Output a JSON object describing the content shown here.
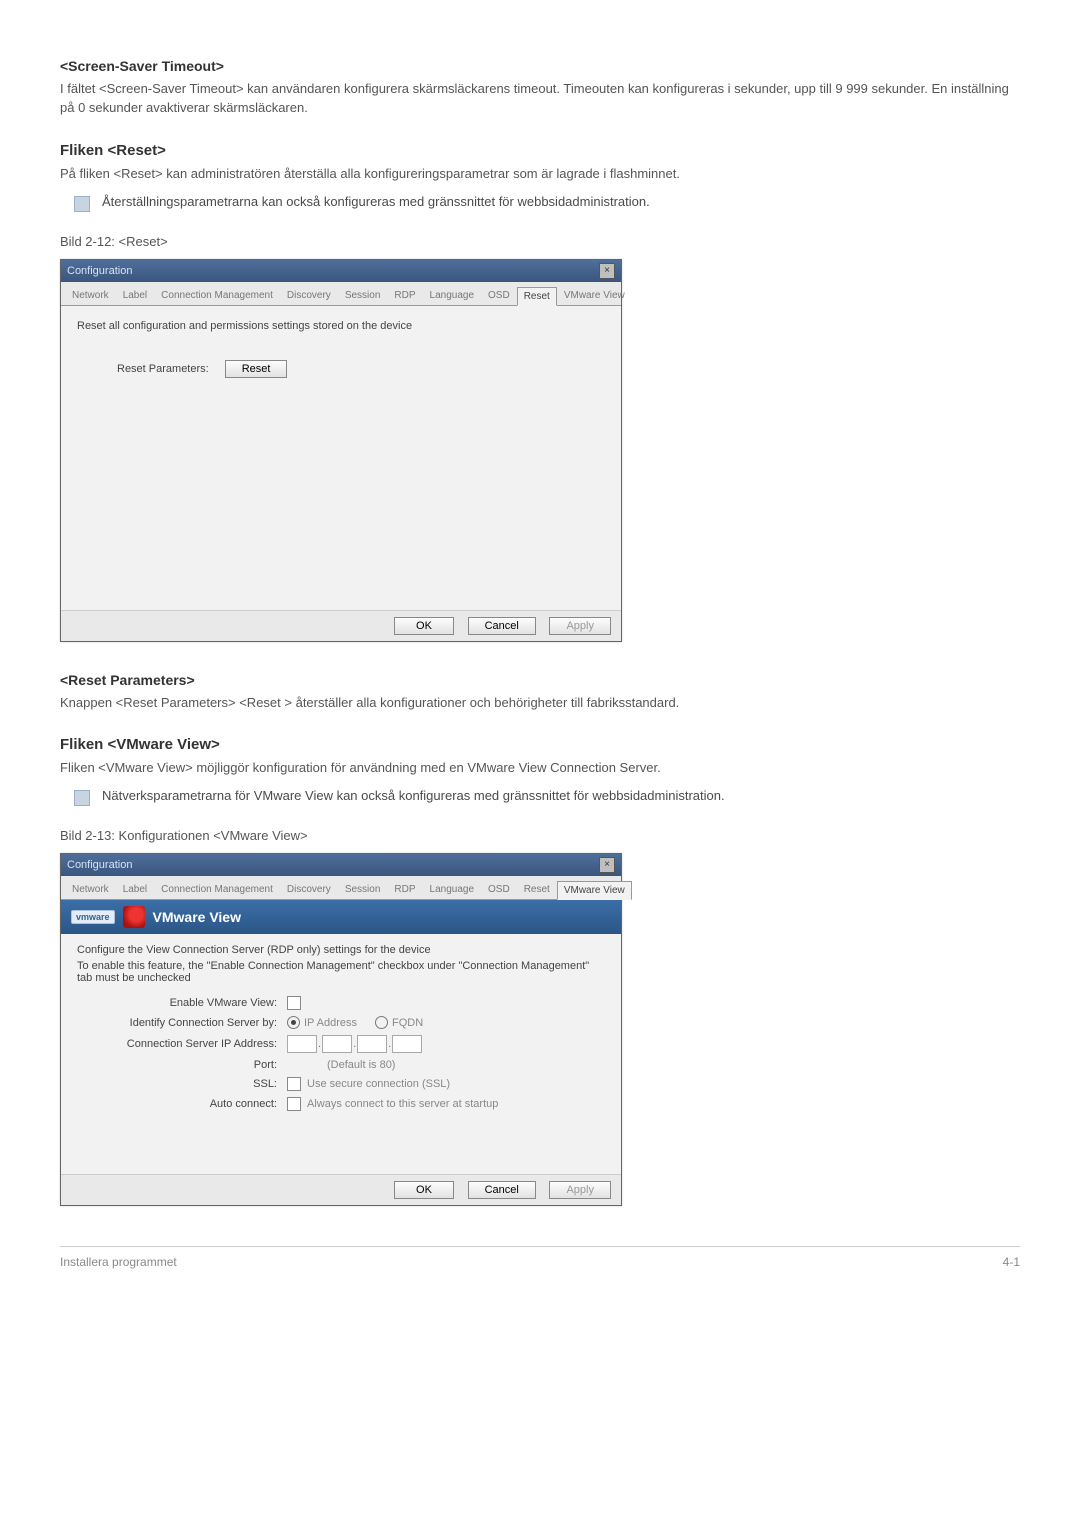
{
  "sections": {
    "screensaver": {
      "title": "<Screen-Saver Timeout>",
      "body": "I fältet <Screen-Saver Timeout> kan användaren konfigurera skärmsläckarens timeout. Timeouten kan konfigureras i sekunder, upp till 9 999 sekunder. En inställning på 0 sekunder avaktiverar skärmsläckaren."
    },
    "reset_tab": {
      "title": "Fliken <Reset>",
      "body": "På fliken <Reset> kan administratören återställa alla konfigureringsparametrar som är lagrade i flashminnet.",
      "note": "Återställningsparametrarna kan också konfigureras med gränssnittet för webbsidadministration.",
      "caption": "Bild 2-12: <Reset>"
    },
    "reset_params": {
      "title": "<Reset Parameters>",
      "body": "Knappen <Reset Parameters> <Reset > återställer alla konfigurationer och behörigheter till fabriksstandard."
    },
    "vmware_tab": {
      "title": "Fliken <VMware View>",
      "body": "Fliken <VMware View> möjliggör konfiguration för användning med en VMware View Connection Server.",
      "note": "Nätverksparametrarna för VMware View kan också konfigureras med gränssnittet för webbsidadministration.",
      "caption": "Bild 2-13: Konfigurationen <VMware View>"
    }
  },
  "dialog": {
    "title": "Configuration",
    "tabs": [
      "Network",
      "Label",
      "Connection Management",
      "Discovery",
      "Session",
      "RDP",
      "Language",
      "OSD",
      "Reset",
      "VMware View"
    ],
    "active_reset_index": 8,
    "active_vmware_index": 9,
    "buttons": {
      "ok": "OK",
      "cancel": "Cancel",
      "apply": "Apply"
    }
  },
  "reset_dialog": {
    "desc": "Reset all configuration and permissions settings stored on the device",
    "label": "Reset Parameters:",
    "btn": "Reset"
  },
  "vmware_dialog": {
    "badge": "vmware",
    "header": "VMware View",
    "line1": "Configure the View Connection Server (RDP only) settings for the device",
    "line2": "To enable this feature, the \"Enable Connection Management\" checkbox under \"Connection Management\" tab must be unchecked",
    "fields": {
      "enable": "Enable VMware View:",
      "identify": "Identify Connection Server by:",
      "ip_radio": "IP Address",
      "fqdn_radio": "FQDN",
      "ip_label": "Connection Server IP Address:",
      "port": "Port:",
      "port_hint": "(Default is 80)",
      "ssl": "SSL:",
      "ssl_text": "Use secure connection (SSL)",
      "auto": "Auto connect:",
      "auto_text": "Always connect to this server at startup"
    }
  },
  "footer": {
    "left": "Installera programmet",
    "right": "4-1"
  }
}
